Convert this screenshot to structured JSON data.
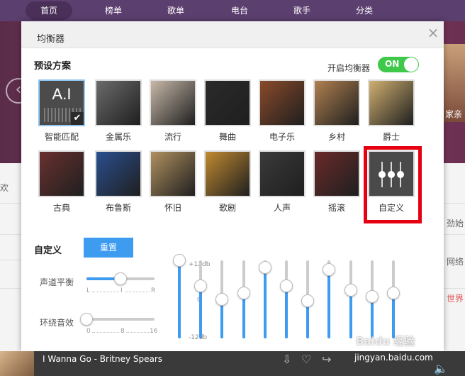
{
  "nav": {
    "items": [
      "首页",
      "榜单",
      "歌单",
      "电台",
      "歌手",
      "分类"
    ]
  },
  "banner": {
    "side_text": "家亲"
  },
  "background": {
    "left_text": "欢",
    "right_texts": [
      "劲始",
      "网络",
      "世界"
    ],
    "right_text_colors": [
      "#666666",
      "#666666",
      "#e05050"
    ]
  },
  "dialog": {
    "title": "均衡器",
    "close_symbol": "×",
    "preset_heading": "预设方案",
    "eq_switch_label": "开启均衡器",
    "eq_switch_state": "ON",
    "presets": [
      {
        "label": "智能匹配",
        "thumb_text": "A.I",
        "selected": true,
        "icon": "ai-thumbnail"
      },
      {
        "label": "金属乐",
        "icon": "metal-thumbnail",
        "color": "#6b6b6b"
      },
      {
        "label": "流行",
        "icon": "pop-thumbnail",
        "color": "#c8b8a8"
      },
      {
        "label": "舞曲",
        "icon": "dance-thumbnail",
        "color": "#2a2a2a"
      },
      {
        "label": "电子乐",
        "icon": "electronic-thumbnail",
        "color": "#8a4a2a"
      },
      {
        "label": "乡村",
        "icon": "country-thumbnail",
        "color": "#b08050"
      },
      {
        "label": "爵士",
        "icon": "jazz-thumbnail",
        "color": "#d0b070"
      },
      {
        "label": "古典",
        "icon": "classical-thumbnail",
        "color": "#6a3030"
      },
      {
        "label": "布鲁斯",
        "icon": "blues-thumbnail",
        "color": "#2a4f8f"
      },
      {
        "label": "怀旧",
        "icon": "nostalgia-thumbnail",
        "color": "#b09060"
      },
      {
        "label": "歌剧",
        "icon": "opera-thumbnail",
        "color": "#c08a30"
      },
      {
        "label": "人声",
        "icon": "vocal-thumbnail",
        "color": "#3a3a3a"
      },
      {
        "label": "摇滚",
        "icon": "rock-thumbnail",
        "color": "#6a2a2a"
      },
      {
        "label": "自定义",
        "icon": "custom-sliders-icon",
        "highlighted": true
      }
    ],
    "custom_heading": "自定义",
    "reset_label": "重置",
    "balance": {
      "label": "声道平衡",
      "value": 0.5,
      "ticks": [
        "L",
        "I",
        "R"
      ]
    },
    "surround": {
      "label": "环绕音效",
      "value": 0,
      "ticks": [
        "0",
        "8",
        "16"
      ]
    },
    "db_labels": {
      "top": "+12db",
      "mid": "0",
      "bottom": "-12db"
    },
    "bands": [
      0.0,
      0.33,
      0.5,
      0.42,
      0.09,
      0.33,
      0.52,
      0.12,
      0.38,
      0.46,
      0.42
    ],
    "accent_color": "#3d9bf0",
    "toggle_color": "#3fc94a",
    "highlight_color": "#e60012"
  },
  "player": {
    "now_playing": "I Wanna Go - Britney Spears",
    "watermark": "Baidu 经验",
    "watermark_url": "jingyan.baidu.com"
  }
}
